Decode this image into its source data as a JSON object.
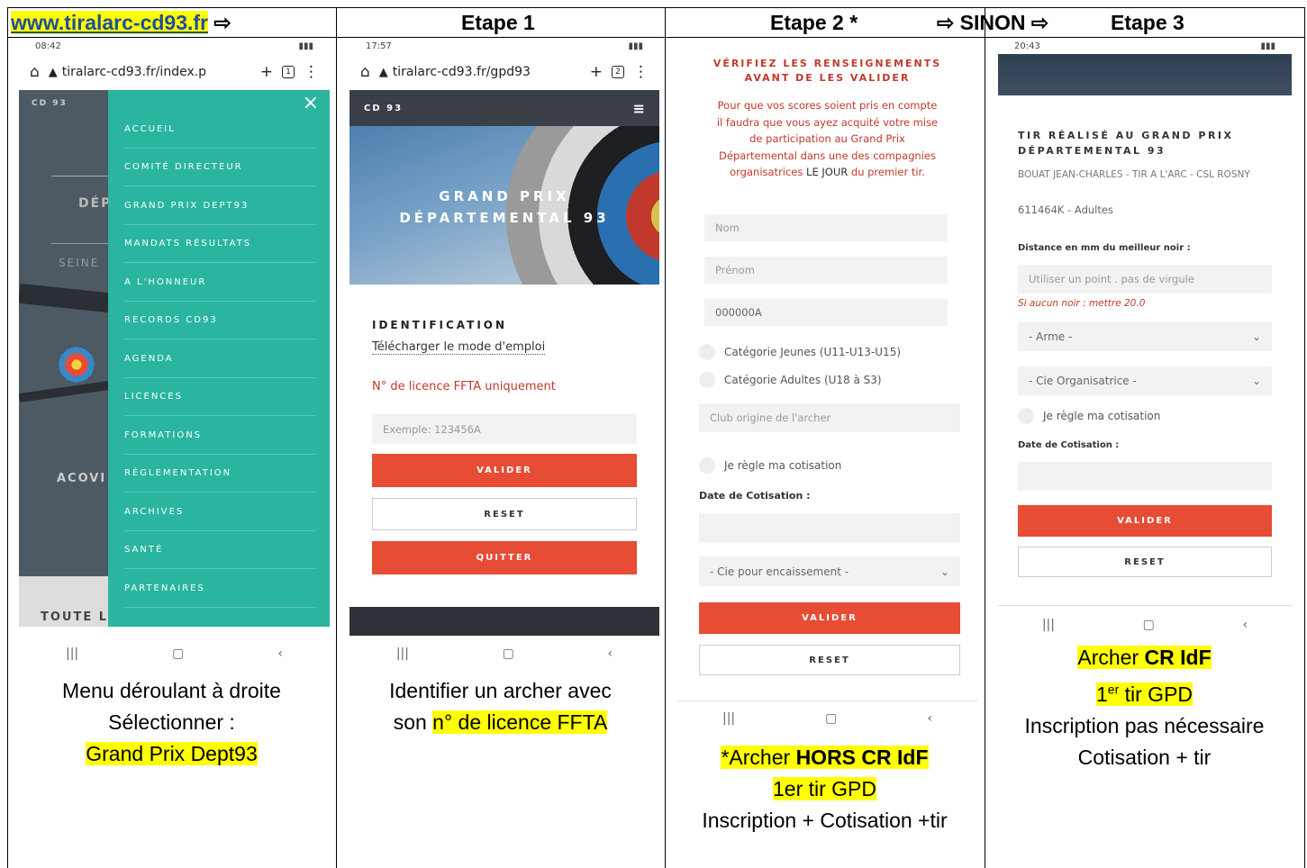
{
  "headers": {
    "website": "www.tiralarc-cd93.fr",
    "website_arrow": "⇨",
    "etape1": "Etape 1",
    "etape2": "Etape 2 *",
    "sinon": "⇨ SINON ⇨",
    "etape3": "Etape 3"
  },
  "panel1": {
    "status_time": "08:42",
    "url": "tiralarc-cd93.fr/index.p",
    "tab_count": "1",
    "brand": "CD 93",
    "bg_texts": [
      "DÉP",
      "SEINE",
      "ACOVI",
      "TOUTE L"
    ],
    "menu": [
      "ACCUEIL",
      "COMITÉ DIRECTEUR",
      "GRAND PRIX DEPT93",
      "MANDATS RÉSULTATS",
      "A L'HONNEUR",
      "RECORDS CD93",
      "AGENDA",
      "LICENCES",
      "FORMATIONS",
      "RÈGLEMENTATION",
      "ARCHIVES",
      "SANTÉ",
      "PARTENAIRES"
    ]
  },
  "panel2": {
    "status_time": "17:57",
    "url": "tiralarc-cd93.fr/gpd93",
    "tab_count": "2",
    "brand": "CD 93",
    "hero_line1": "GRAND PRIX",
    "hero_line2": "DÉPARTEMENTAL 93",
    "section_title": "IDENTIFICATION",
    "download_link": "Télécharger le mode d'emploi",
    "licence_note": "N° de licence FFTA uniquement",
    "licence_placeholder": "Exemple: 123456A",
    "btn_valider": "VALIDER",
    "btn_reset": "RESET",
    "btn_quitter": "QUITTER"
  },
  "panel3": {
    "warning_title_1": "VÉRIFIEZ LES RENSEIGNEMENTS",
    "warning_title_2": "AVANT DE LES VALIDER",
    "warning_text_1": "Pour que vos scores soient pris en compte",
    "warning_text_2": "il faudra que vous ayez acquité votre mise",
    "warning_text_3": "de participation au Grand Prix",
    "warning_text_4": "Départemental dans une des compagnies",
    "warning_text_5_pre": "organisatrices ",
    "warning_text_5_bold": "LE JOUR",
    "warning_text_5_post": " du premier tir.",
    "field_nom": "Nom",
    "field_prenom": "Prénom",
    "field_licence": "000000A",
    "radio_jeunes": "Catégorie Jeunes (U11-U13-U15)",
    "radio_adultes": "Catégorie Adultes (U18 à S3)",
    "field_club": "Club origine de l'archer",
    "radio_cotisation": "Je règle ma cotisation",
    "label_date": "Date de Cotisation :",
    "select_cie": "- Cie pour encaissement -",
    "btn_valider": "VALIDER",
    "btn_reset": "RESET"
  },
  "panel4": {
    "status_time": "20:43",
    "title_1": "TIR RÉALISÉ AU GRAND PRIX",
    "title_2": "DÉPARTEMENTAL 93",
    "archer_name": "BOUAT JEAN-CHARLES - TIR A L'ARC - CSL ROSNY",
    "archer_licence": "611464K - Adultes",
    "label_distance": "Distance en mm du meilleur noir :",
    "distance_placeholder": "Utiliser un point . pas de virgule",
    "hint": "Si aucun noir : mettre 20.0",
    "select_arme": "- Arme -",
    "select_cie": "- Cie Organisatrice -",
    "radio_cotisation": "Je règle ma cotisation",
    "label_date": "Date de Cotisation :",
    "btn_valider": "VALIDER",
    "btn_reset": "RESET"
  },
  "navbar_icons": [
    "|||",
    "▢",
    "‹"
  ],
  "captions": {
    "c1_line1": "Menu déroulant à droite",
    "c1_line2": "Sélectionner :",
    "c1_line3": "Grand Prix Dept93",
    "c2_line1": "Identifier un archer avec",
    "c2_line2_pre": "son ",
    "c2_line2_hl": "n° de licence FFTA",
    "c3_line1_pre": "*Archer ",
    "c3_line1_bold": "HORS CR IdF",
    "c3_line2": "1er tir GPD",
    "c3_line3": "Inscription + Cotisation +tir",
    "c4_line1_pre": "Archer ",
    "c4_line1_bold": "CR IdF",
    "c4_line2_num": "1",
    "c4_line2_sup": "er",
    "c4_line2_rest": " tir GPD",
    "c4_line3": "Inscription pas nécessaire",
    "c4_line4": "Cotisation + tir"
  },
  "colors": {
    "teal": "#2ab5a0",
    "red": "#e74c35",
    "dark": "#3a3f48",
    "highlight": "#ffff00",
    "link_blue": "#1f4e9c"
  }
}
